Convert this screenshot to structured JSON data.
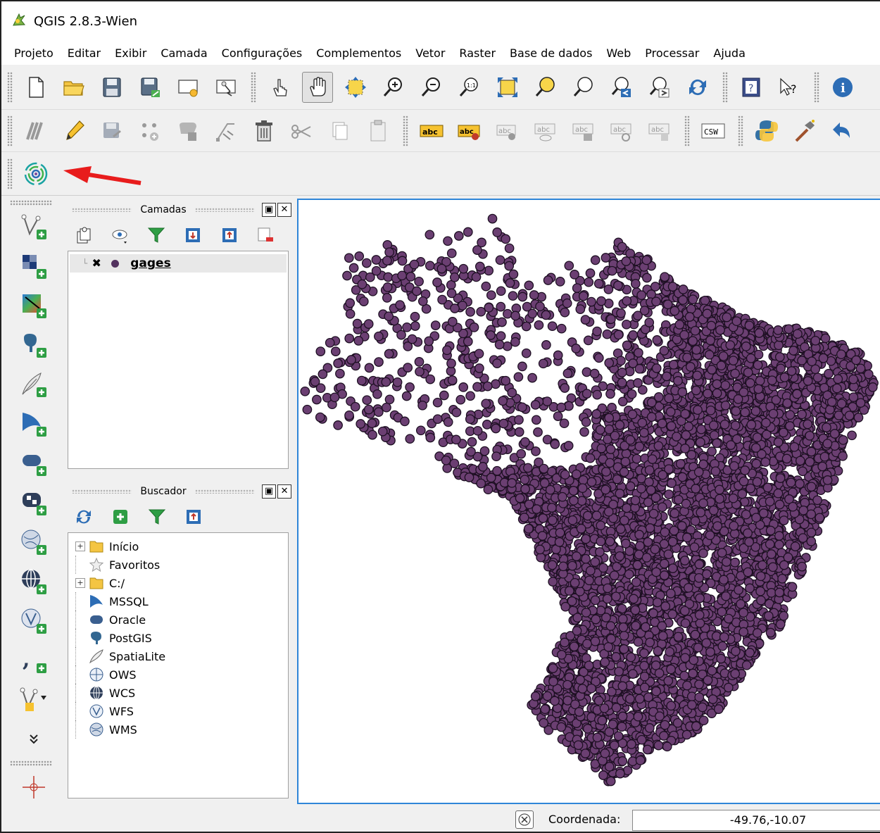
{
  "window": {
    "title": "QGIS 2.8.3-Wien"
  },
  "menu": [
    "Projeto",
    "Editar",
    "Exibir",
    "Camada",
    "Configurações",
    "Complementos",
    "Vetor",
    "Raster",
    "Base de dados",
    "Web",
    "Processar",
    "Ajuda"
  ],
  "toolbar_labels": {
    "abc": "abc",
    "csw": "CSW"
  },
  "layers_panel": {
    "title": "Camadas",
    "layers": [
      {
        "name": "gages",
        "checked": true,
        "symbol_color": "#53325f"
      }
    ]
  },
  "browser_panel": {
    "title": "Buscador",
    "items": [
      {
        "label": "Início",
        "icon": "folder-icon",
        "expandable": true
      },
      {
        "label": "Favoritos",
        "icon": "star-icon",
        "expandable": false
      },
      {
        "label": "C:/",
        "icon": "folder-icon",
        "expandable": true
      },
      {
        "label": "MSSQL",
        "icon": "mssql-icon",
        "expandable": false
      },
      {
        "label": "Oracle",
        "icon": "oracle-icon",
        "expandable": false
      },
      {
        "label": "PostGIS",
        "icon": "postgis-icon",
        "expandable": false
      },
      {
        "label": "SpatiaLite",
        "icon": "spatialite-icon",
        "expandable": false
      },
      {
        "label": "OWS",
        "icon": "ows-icon",
        "expandable": false
      },
      {
        "label": "WCS",
        "icon": "wcs-icon",
        "expandable": false
      },
      {
        "label": "WFS",
        "icon": "wfs-icon",
        "expandable": false
      },
      {
        "label": "WMS",
        "icon": "wms-icon",
        "expandable": false
      }
    ]
  },
  "status": {
    "coord_label": "Coordenada:",
    "coord_value": "-49.76,-10.07"
  },
  "colors": {
    "points_fill": "#6b3f72",
    "points_stroke": "#1d0f22",
    "map_border": "#2f86d8",
    "annotation": "#e81c1c"
  }
}
